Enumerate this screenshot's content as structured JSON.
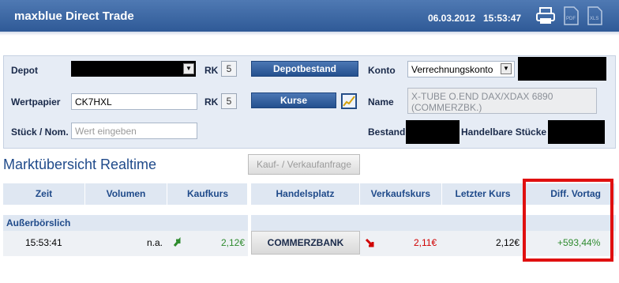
{
  "header": {
    "brand": "maxblue Direct Trade",
    "date": "06.03.2012",
    "time": "15:53:47",
    "icons": [
      "printer-icon",
      "pdf-icon",
      "xls-icon"
    ]
  },
  "form": {
    "depot_label": "Depot",
    "rk_label": "RK",
    "rk1_value": "5",
    "depotbestand_button": "Depotbestand",
    "konto_label": "Konto",
    "konto_select": "Verrechnungskonto",
    "wertpapier_label": "Wertpapier",
    "wertpapier_value": "CK7HXL",
    "rk2_value": "5",
    "kurse_button": "Kurse",
    "name_label": "Name",
    "name_value": "X-TUBE O.END DAX/XDAX 6890 (COMMERZBK.)",
    "stueck_label": "Stück / Nom.",
    "stueck_placeholder": "Wert eingeben",
    "bestand_label": "Bestand",
    "handelbare_label": "Handelbare Stücke"
  },
  "market": {
    "title": "Marktübersicht Realtime",
    "order_button": "Kauf- / Verkaufanfrage",
    "columns": {
      "zeit": "Zeit",
      "volumen": "Volumen",
      "kaufkurs": "Kaufkurs",
      "handelsplatz": "Handelsplatz",
      "verkaufskurs": "Verkaufskurs",
      "letzter_kurs": "Letzter Kurs",
      "diff_vortag": "Diff. Vortag"
    },
    "group_label": "Außerbörslich",
    "row": {
      "zeit": "15:53:41",
      "volumen": "n.a.",
      "kaufkurs": "2,12€",
      "handelsplatz": "COMMERZBANK",
      "verkaufskurs": "2,11€",
      "letzter_kurs": "2,12€",
      "diff_vortag": "+593,44%"
    }
  },
  "colors": {
    "brand_blue": "#2f5a97",
    "positive": "#2e8b2e",
    "negative": "#d00000",
    "highlight": "#e01010"
  }
}
